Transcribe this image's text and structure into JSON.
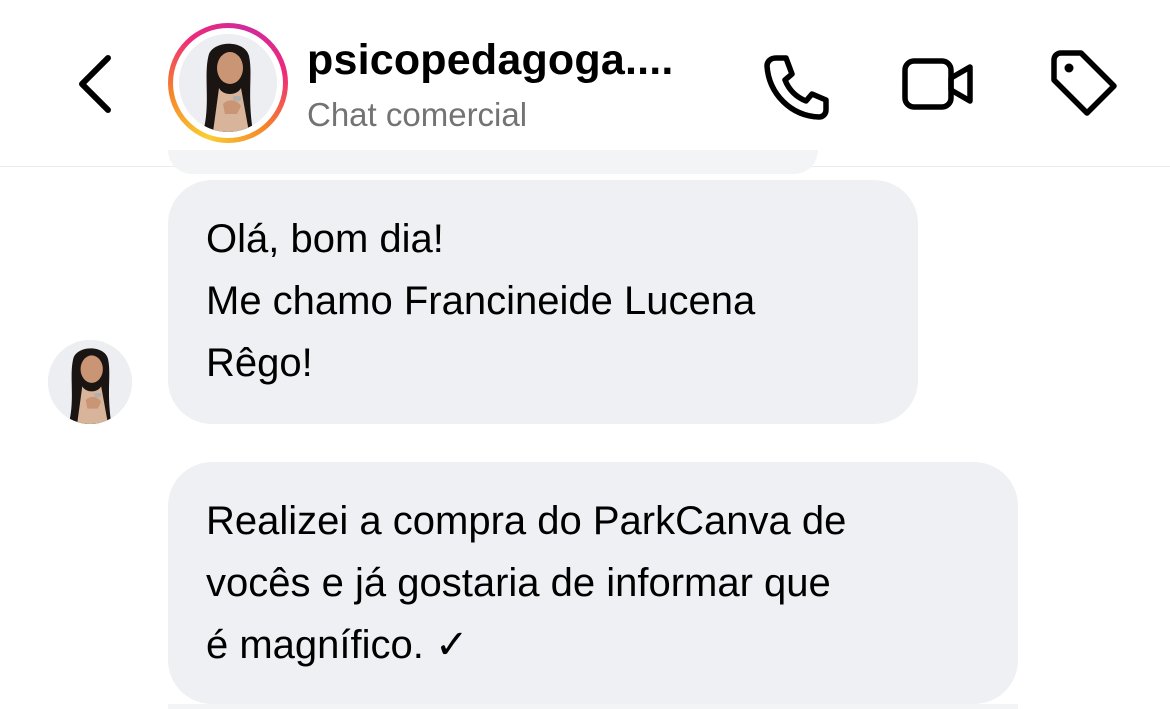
{
  "header": {
    "contact_name": "psicopedagoga....",
    "subtitle": "Chat comercial",
    "icons": {
      "back": "chevron-left-icon",
      "call": "phone-icon",
      "video": "video-camera-icon",
      "label": "tag-icon"
    }
  },
  "messages": [
    {
      "lines": [
        "Olá, bom dia!",
        "Me chamo Francineide Lucena",
        "Rêgo!"
      ]
    },
    {
      "lines": [
        "Realizei a compra do ParkCanva de",
        "vocês e já gostaria de informar que",
        "é magnífico. ✓"
      ]
    }
  ],
  "colors": {
    "bubble": "#eff0f3",
    "subtitle": "#737373",
    "story_ring": [
      "#f9ce34",
      "#ee2a7b",
      "#f58529"
    ]
  }
}
